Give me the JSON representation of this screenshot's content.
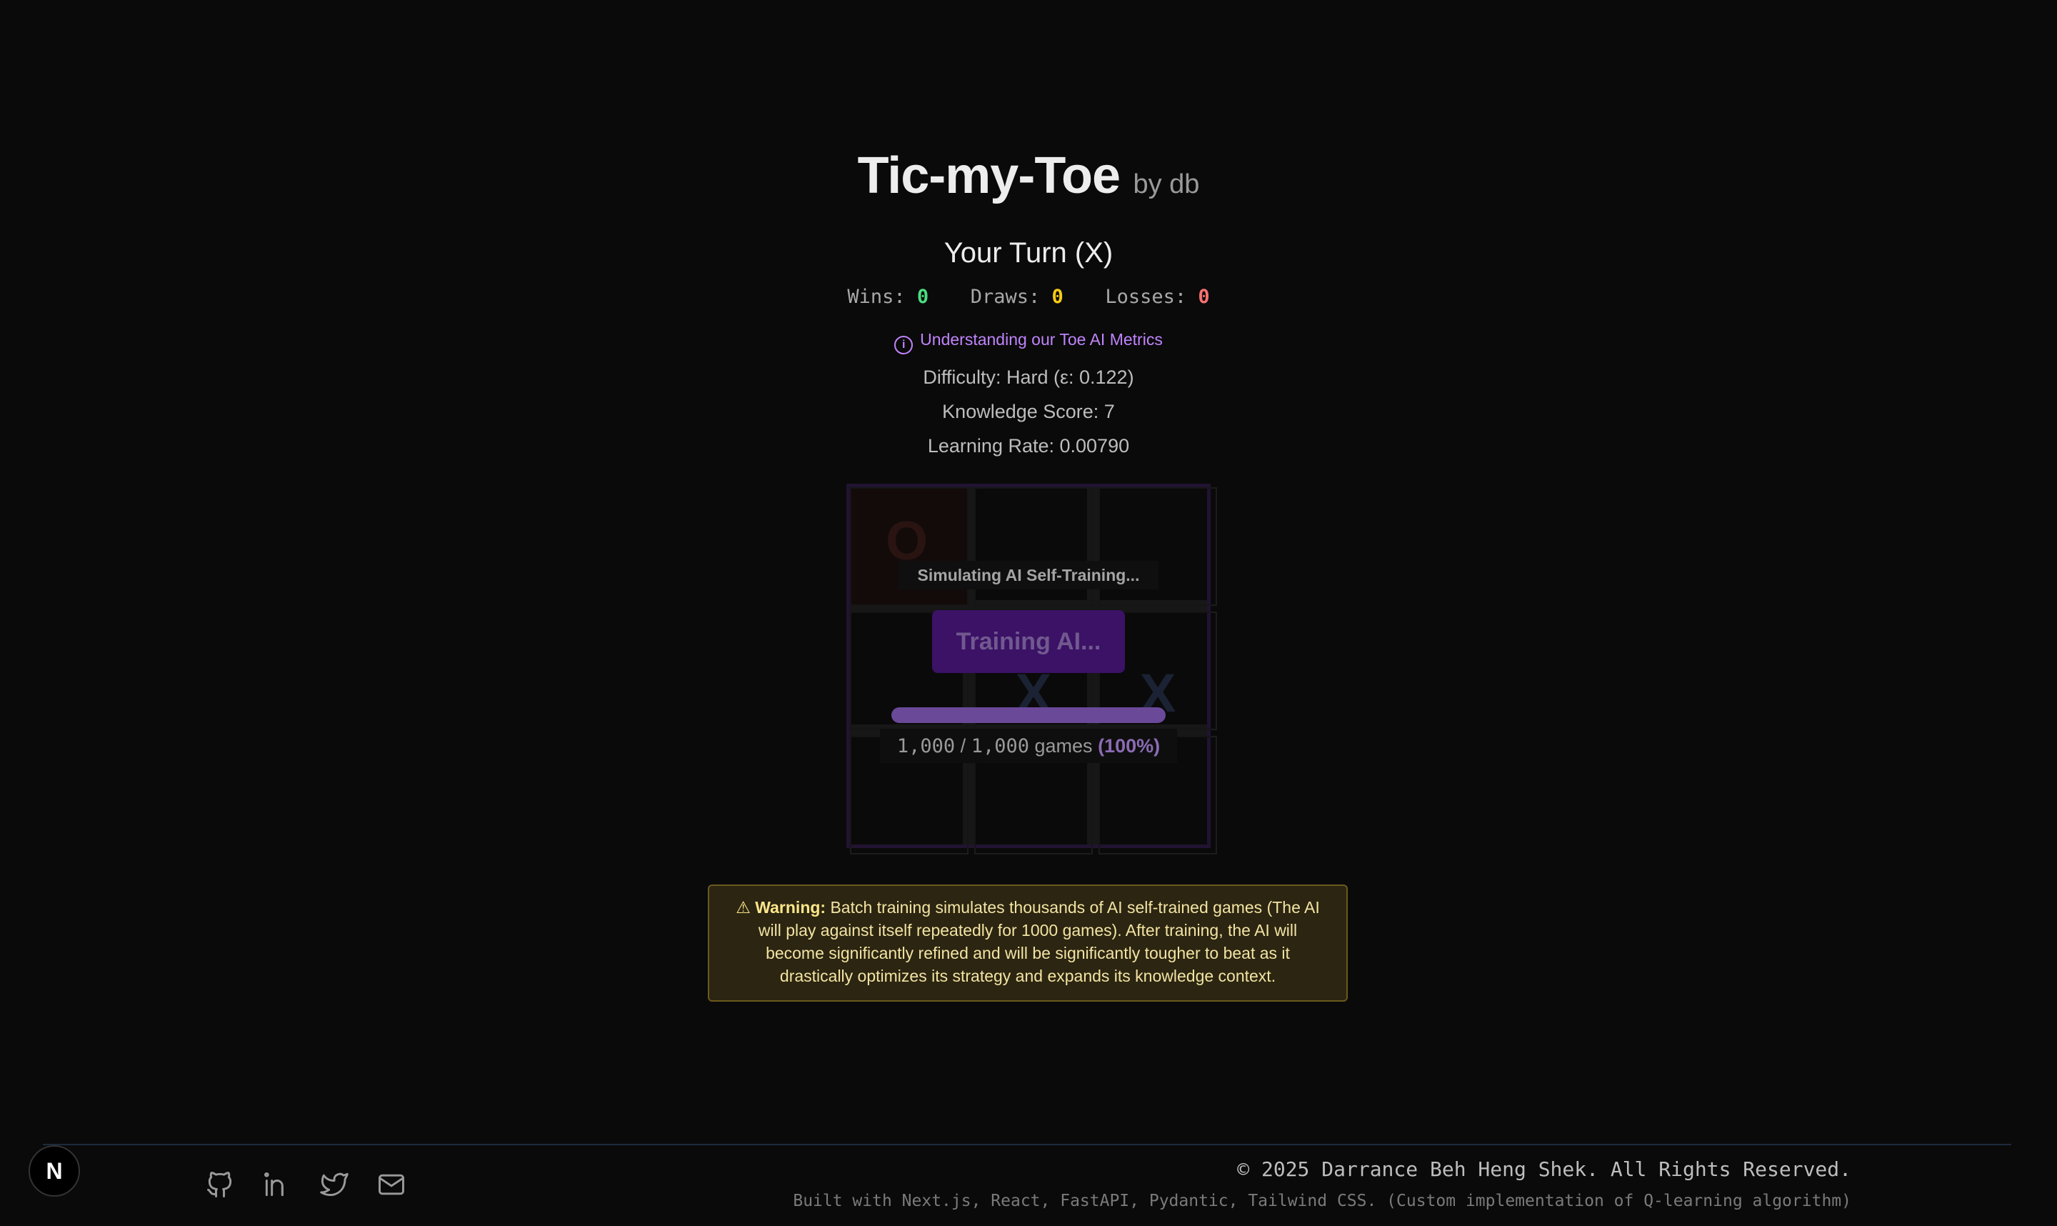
{
  "header": {
    "title": "Tic-my-Toe",
    "byline": "by db",
    "turn_status": "Your Turn (X)"
  },
  "score": {
    "wins_label": "Wins:",
    "wins": "0",
    "draws_label": "Draws:",
    "draws": "0",
    "losses_label": "Losses:",
    "losses": "0"
  },
  "metrics_link": {
    "icon": "info-icon",
    "label": "Understanding our Toe AI Metrics"
  },
  "ai_info": {
    "difficulty": "Difficulty: Hard (ε: 0.122)",
    "knowledge": "Knowledge Score: 7",
    "learning_rate": "Learning Rate: 0.00790"
  },
  "board": {
    "cells": [
      "O",
      "",
      "",
      "",
      "X",
      "X",
      "",
      "",
      ""
    ]
  },
  "training": {
    "status_text": "Simulating AI Self-Training...",
    "button_label": "Training AI...",
    "progress_fraction": 1.0,
    "games_done": "1,000",
    "separator": "/",
    "games_total": "1,000",
    "games_unit": "games",
    "percent": "(100%)"
  },
  "warning": {
    "icon": "warning-icon",
    "icon_glyph": "⚠",
    "label": "Warning:",
    "text": "Batch training simulates thousands of AI self-trained games (The AI will play against itself repeatedly for 1000 games). After training, the AI will become significantly refined and will be significantly tougher to beat as it drastically optimizes its strategy and expands its knowledge context."
  },
  "footer": {
    "badge": "N",
    "socials": [
      "github-icon",
      "linkedin-icon",
      "twitter-icon",
      "mail-icon"
    ],
    "copyright": "© 2025 Darrance Beh Heng Shek. All Rights Reserved.",
    "built_with": "Built with Next.js, React, FastAPI, Pydantic, Tailwind CSS. (Custom implementation of Q-learning algorithm)"
  },
  "colors": {
    "background": "#0a0a0a",
    "win": "#4ade80",
    "draw": "#facc15",
    "loss": "#f87171",
    "accent": "#c084fc",
    "warning_bg": "#2b2511"
  }
}
